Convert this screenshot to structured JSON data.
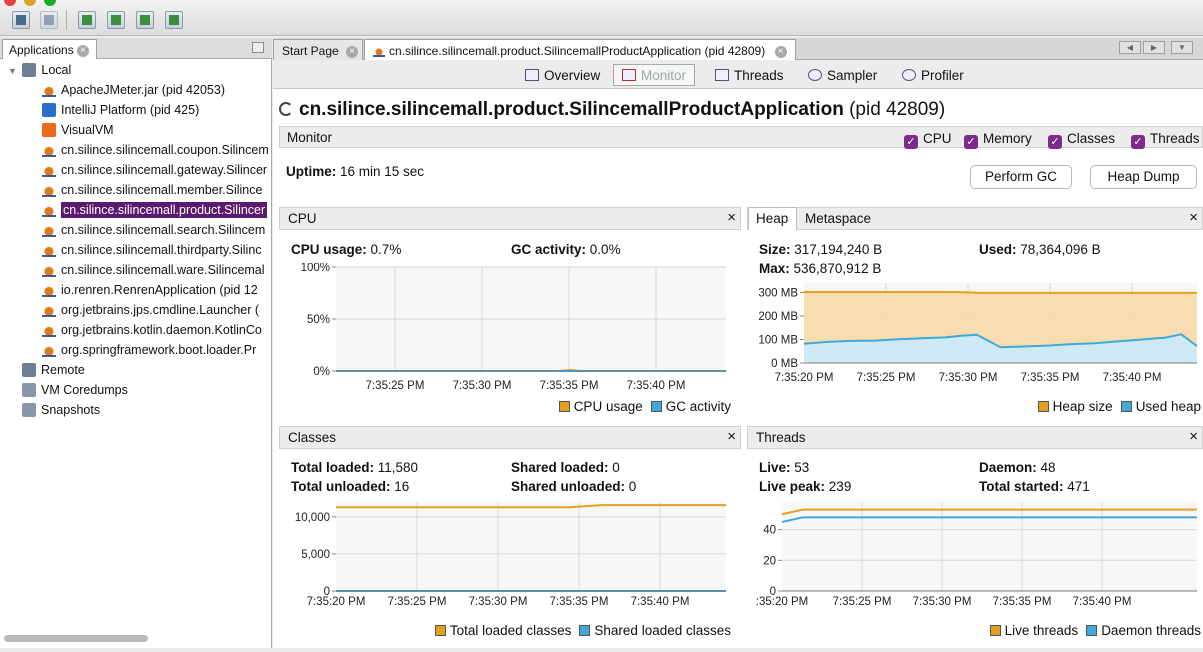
{
  "toolbar": {
    "buttons": [
      "open-icon",
      "save-icon",
      "add-jmx-icon",
      "heap-dump-icon",
      "thread-dump-icon",
      "snapshot-icon"
    ]
  },
  "sidebar": {
    "tab_label": "Applications",
    "local_label": "Local",
    "items": [
      {
        "label": "ApacheJMeter.jar (pid 42053)",
        "icon": "java-icon"
      },
      {
        "label": "IntelliJ Platform (pid 425)",
        "icon": "intellij-icon"
      },
      {
        "label": "VisualVM",
        "icon": "visualvm-icon"
      },
      {
        "label": "cn.silince.silincemall.coupon.Silincem",
        "icon": "java-icon"
      },
      {
        "label": "cn.silince.silincemall.gateway.Silincer",
        "icon": "java-icon"
      },
      {
        "label": "cn.silince.silincemall.member.Silince",
        "icon": "java-icon"
      },
      {
        "label": "cn.silince.silincemall.product.Silincer",
        "icon": "java-icon",
        "selected": true
      },
      {
        "label": "cn.silince.silincemall.search.Silincem",
        "icon": "java-icon"
      },
      {
        "label": "cn.silince.silincemall.thirdparty.Silinc",
        "icon": "java-icon"
      },
      {
        "label": "cn.silince.silincemall.ware.Silincemal",
        "icon": "java-icon"
      },
      {
        "label": "io.renren.RenrenApplication (pid 12",
        "icon": "java-icon"
      },
      {
        "label": "org.jetbrains.jps.cmdline.Launcher (",
        "icon": "java-icon"
      },
      {
        "label": "org.jetbrains.kotlin.daemon.KotlinCo",
        "icon": "java-icon"
      },
      {
        "label": "org.springframework.boot.loader.Pr",
        "icon": "java-icon"
      }
    ],
    "remote_label": "Remote",
    "coredumps_label": "VM Coredumps",
    "snapshots_label": "Snapshots"
  },
  "tabs": {
    "start": "Start Page",
    "app": "cn.silince.silincemall.product.SilincemallProductApplication (pid 42809)"
  },
  "views": [
    "Overview",
    "Monitor",
    "Threads",
    "Sampler",
    "Profiler"
  ],
  "title": {
    "name": "cn.silince.silincemall.product.SilincemallProductApplication",
    "pid": "(pid 42809)"
  },
  "monitor": {
    "label": "Monitor",
    "checks": [
      "CPU",
      "Memory",
      "Classes",
      "Threads"
    ],
    "uptime_label": "Uptime:",
    "uptime_value": "16 min 15 sec",
    "gc_button": "Perform GC",
    "heapdump_button": "Heap Dump"
  },
  "cpu": {
    "title": "CPU",
    "usage_label": "CPU usage:",
    "usage_value": "0.7%",
    "gc_label": "GC activity:",
    "gc_value": "0.0%",
    "legend": [
      "CPU usage",
      "GC activity"
    ]
  },
  "heap": {
    "tab1": "Heap",
    "tab2": "Metaspace",
    "size_label": "Size:",
    "size_value": "317,194,240 B",
    "used_label": "Used:",
    "used_value": "78,364,096 B",
    "max_label": "Max:",
    "max_value": "536,870,912 B",
    "legend": [
      "Heap size",
      "Used heap"
    ]
  },
  "classes": {
    "title": "Classes",
    "total_loaded_label": "Total loaded:",
    "total_loaded_value": "11,580",
    "shared_loaded_label": "Shared loaded:",
    "shared_loaded_value": "0",
    "total_unloaded_label": "Total unloaded:",
    "total_unloaded_value": "16",
    "shared_unloaded_label": "Shared unloaded:",
    "shared_unloaded_value": "0",
    "legend": [
      "Total loaded classes",
      "Shared loaded classes"
    ]
  },
  "threads": {
    "title": "Threads",
    "live_label": "Live:",
    "live_value": "53",
    "daemon_label": "Daemon:",
    "daemon_value": "48",
    "peak_label": "Live peak:",
    "peak_value": "239",
    "started_label": "Total started:",
    "started_value": "471",
    "legend": [
      "Live threads",
      "Daemon threads"
    ]
  },
  "colors": {
    "orange": "#e6a020",
    "blue": "#3fa9d8",
    "orange_fill": "#f7d9a8",
    "blue_fill": "#cfeaf7",
    "selection": "#5b1a6e",
    "check": "#7c2a8c"
  },
  "chart_data": [
    {
      "type": "line",
      "title": "CPU",
      "x": [
        "7:35:25 PM",
        "7:35:30 PM",
        "7:35:35 PM",
        "7:35:40 PM"
      ],
      "ytick_labels": [
        "0%",
        "50%",
        "100%"
      ],
      "ylim": [
        0,
        100
      ],
      "series": [
        {
          "name": "CPU usage",
          "color": "#e6a020",
          "x": [
            0,
            0.2,
            0.4,
            0.57,
            0.6,
            0.63,
            0.8,
            1
          ],
          "values": [
            0,
            0,
            0,
            0,
            1,
            0,
            0,
            0
          ]
        },
        {
          "name": "GC activity",
          "color": "#3fa9d8",
          "x": [
            0,
            1
          ],
          "values": [
            0,
            0
          ]
        }
      ]
    },
    {
      "type": "area",
      "title": "Heap",
      "x": [
        "7:35:20 PM",
        "7:35:25 PM",
        "7:35:30 PM",
        "7:35:35 PM",
        "7:35:40 PM"
      ],
      "ytick_labels": [
        "0 MB",
        "100 MB",
        "200 MB",
        "300 MB"
      ],
      "ylim": [
        0,
        340
      ],
      "series": [
        {
          "name": "Heap size",
          "color": "#e6a020",
          "x": [
            0,
            0.38,
            0.42,
            0.45,
            1
          ],
          "values": [
            302,
            302,
            300,
            298,
            298
          ]
        },
        {
          "name": "Used heap",
          "color": "#3fa9d8",
          "x": [
            0,
            0.06,
            0.12,
            0.18,
            0.24,
            0.3,
            0.36,
            0.4,
            0.44,
            0.5,
            0.56,
            0.62,
            0.68,
            0.74,
            0.8,
            0.86,
            0.92,
            0.96,
            1
          ],
          "values": [
            82,
            90,
            94,
            95,
            101,
            105,
            109,
            116,
            120,
            67,
            70,
            74,
            80,
            84,
            92,
            100,
            108,
            122,
            72
          ]
        }
      ]
    },
    {
      "type": "line",
      "title": "Classes",
      "x": [
        "7:35:20 PM",
        "7:35:25 PM",
        "7:35:30 PM",
        "7:35:35 PM",
        "7:35:40 PM"
      ],
      "ytick_labels": [
        "0",
        "5,000",
        "10,000"
      ],
      "ylim": [
        0,
        12000
      ],
      "series": [
        {
          "name": "Total loaded classes",
          "color": "#e6a020",
          "x": [
            0,
            0.6,
            0.68,
            1
          ],
          "values": [
            11300,
            11300,
            11580,
            11580
          ]
        },
        {
          "name": "Shared loaded classes",
          "color": "#3fa9d8",
          "x": [
            0,
            1
          ],
          "values": [
            0,
            0
          ]
        }
      ]
    },
    {
      "type": "line",
      "title": "Threads",
      "x": [
        ":35:20 PM",
        "7:35:25 PM",
        "7:35:30 PM",
        "7:35:35 PM",
        "7:35:40 PM"
      ],
      "ytick_labels": [
        "0",
        "20",
        "40"
      ],
      "ylim": [
        0,
        58
      ],
      "series": [
        {
          "name": "Live threads",
          "color": "#e6a020",
          "x": [
            0,
            0.05,
            1
          ],
          "values": [
            50,
            53,
            53
          ]
        },
        {
          "name": "Daemon threads",
          "color": "#3fa9d8",
          "x": [
            0,
            0.05,
            1
          ],
          "values": [
            45,
            48,
            48
          ]
        }
      ]
    }
  ]
}
